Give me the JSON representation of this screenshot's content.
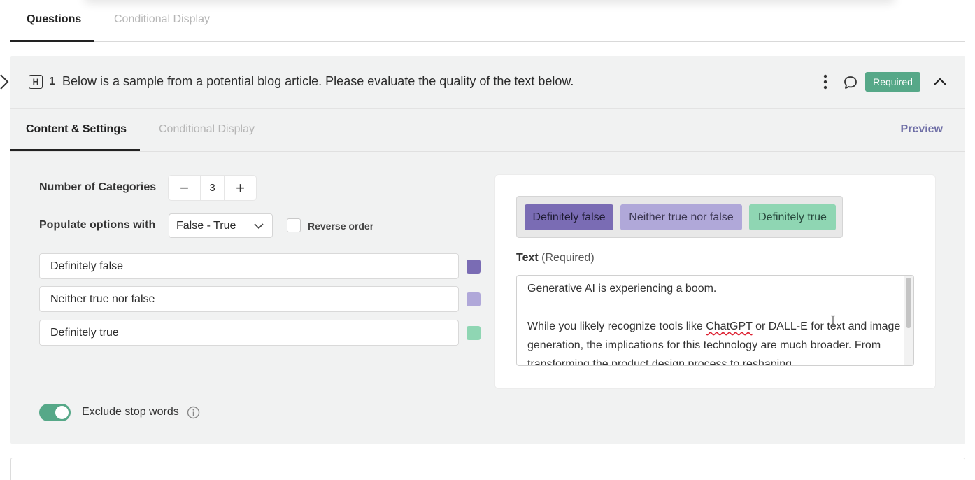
{
  "top_tabs": {
    "questions": "Questions",
    "conditional_display": "Conditional Display"
  },
  "question": {
    "type_icon_letter": "H",
    "number": "1",
    "title": "Below is a sample from a potential blog article. Please evaluate the quality of the text below.",
    "required_badge": "Required"
  },
  "inner_tabs": {
    "content_settings": "Content & Settings",
    "conditional_display": "Conditional Display",
    "preview": "Preview"
  },
  "settings": {
    "num_categories_label": "Number of Categories",
    "num_categories_value": "3",
    "minus_symbol": "−",
    "plus_symbol": "+",
    "populate_label": "Populate options with",
    "populate_value": "False - True",
    "reverse_order_label": "Reverse order",
    "reverse_order_checked": false,
    "options": [
      {
        "label": "Definitely false",
        "color": "#7a6cb4"
      },
      {
        "label": "Neither true nor false",
        "color": "#b0a8d9"
      },
      {
        "label": "Definitely true",
        "color": "#8fd6b3"
      }
    ],
    "exclude_stop_words_label": "Exclude stop words",
    "exclude_stop_words_on": true
  },
  "preview": {
    "chips": [
      "Definitely false",
      "Neither true nor false",
      "Definitely true"
    ],
    "text_label": "Text",
    "text_required": "(Required)",
    "text_line1": "Generative AI is experiencing a boom.",
    "text_line2_pre": "While you likely recognize tools like ",
    "text_line2_misspelled": "ChatGPT",
    "text_line2_post": " or DALL-E for text and image generation, the implications for this technology are much broader. From transforming the product design process to reshaping"
  },
  "colors": {
    "accent_green": "#56a888",
    "preview_purple": "#6e6ea6"
  }
}
